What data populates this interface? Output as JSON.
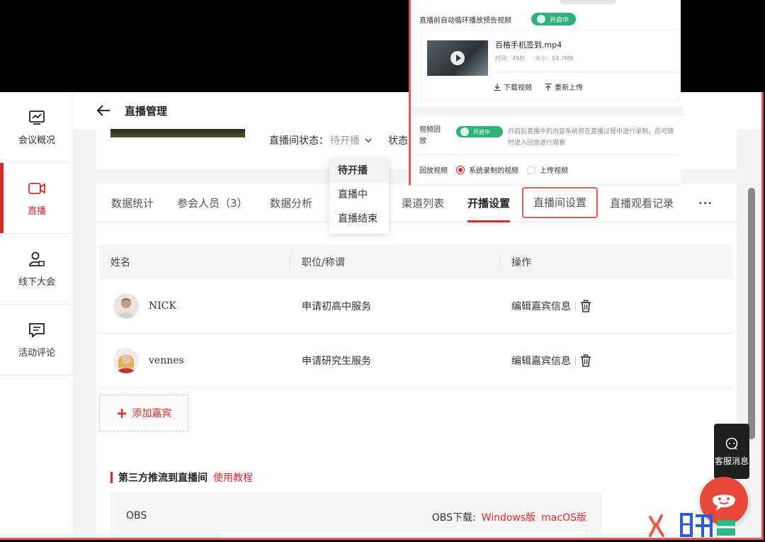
{
  "sidebar": {
    "items": [
      {
        "label": "会议概况",
        "icon": "chart-monitor-icon"
      },
      {
        "label": "直播",
        "icon": "video-camera-icon",
        "active": true
      },
      {
        "label": "线下大会",
        "icon": "user-badge-icon"
      },
      {
        "label": "活动评论",
        "icon": "comment-icon"
      }
    ]
  },
  "header": {
    "title": "直播管理"
  },
  "live_status": {
    "room_label": "直播间状态：",
    "room_value": "待开播",
    "status_label": "状态："
  },
  "status_dropdown": {
    "options": [
      "待开播",
      "直播中",
      "直播结束"
    ],
    "selected": "待开播"
  },
  "tabs": [
    "数据统计",
    "参会人员（3）",
    "数据分析",
    "渠道列表",
    "开播设置",
    "直播间设置",
    "直播观看记录",
    "···"
  ],
  "active_tab": "开播设置",
  "highlighted_tab": "直播间设置",
  "guest_table": {
    "columns": [
      "姓名",
      "职位/称谓",
      "操作"
    ],
    "rows": [
      {
        "name": "NICK",
        "title": "申请初高中服务",
        "action": "编辑嘉宾信息"
      },
      {
        "name": "vennes",
        "title": "申请研究生服务",
        "action": "编辑嘉宾信息"
      }
    ]
  },
  "add_guest_label": "添加嘉宾",
  "third_party": {
    "title": "第三方推流到直播间",
    "tutorial_link": "使用教程",
    "obs_label": "OBS",
    "obs_download_label": "OBS下载:",
    "obs_windows": "Windows版",
    "obs_mac": "macOS版"
  },
  "support": {
    "label": "客服消息"
  },
  "overlay": {
    "preview_label": "直播前自动循环播放预告视频",
    "preview_toggle": "开启中",
    "video_name": "百格手机签到.mp4",
    "video_duration": "时间：49秒",
    "video_size": "大小：54.7MB",
    "download_label": "下载视频",
    "reupload_label": "重新上传",
    "replay_label": "视频回放",
    "replay_toggle": "开启中",
    "replay_desc": "开启后直播中的内容系统将在直播过程中进行录制，员可随时进入回放进行观看",
    "replay_video_label": "回放视频",
    "replay_opt1": "系统录制的视频",
    "replay_opt2": "上传视频"
  },
  "colors": {
    "accent": "#d92a2a",
    "toggle_green": "#2db37a",
    "highlight_border": "#e85a4f"
  }
}
